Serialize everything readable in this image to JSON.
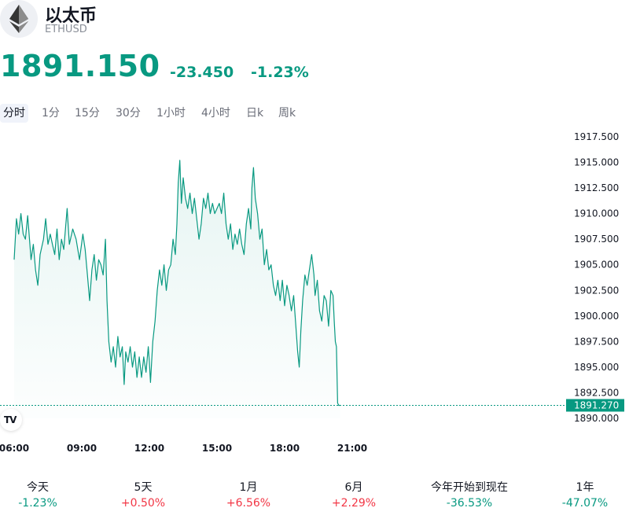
{
  "header": {
    "name": "以太币",
    "ticker": "ETHUSD",
    "price": "1891.150",
    "change": "-23.450",
    "change_pct": "-1.23%"
  },
  "tabs": [
    {
      "label": "分时",
      "active": true
    },
    {
      "label": "1分",
      "active": false
    },
    {
      "label": "15分",
      "active": false
    },
    {
      "label": "30分",
      "active": false
    },
    {
      "label": "1小时",
      "active": false
    },
    {
      "label": "4小时",
      "active": false
    },
    {
      "label": "日k",
      "active": false
    },
    {
      "label": "周k",
      "active": false
    }
  ],
  "colors": {
    "line": "#089981",
    "fill": "#e8f5f2",
    "negative": "#089981",
    "positive": "#f23645"
  },
  "chart_data": {
    "type": "area",
    "x_ticks": [
      "06:00",
      "09:00",
      "12:00",
      "15:00",
      "18:00",
      "21:00"
    ],
    "y_ticks": [
      "1917.500",
      "1915.000",
      "1912.500",
      "1910.000",
      "1907.500",
      "1905.000",
      "1902.500",
      "1900.000",
      "1897.500",
      "1895.000",
      "1892.500",
      "1890.000"
    ],
    "ylim": [
      1890.0,
      1917.5
    ],
    "last_price_label": "1891.270",
    "last_price": 1891.27,
    "x_hours_range": [
      6.0,
      22.25
    ],
    "points": [
      [
        6.0,
        1905.5
      ],
      [
        6.1,
        1909.5
      ],
      [
        6.2,
        1908.0
      ],
      [
        6.3,
        1910.0
      ],
      [
        6.4,
        1908.0
      ],
      [
        6.5,
        1907.5
      ],
      [
        6.6,
        1909.8
      ],
      [
        6.75,
        1905.5
      ],
      [
        6.85,
        1907.0
      ],
      [
        6.95,
        1904.5
      ],
      [
        7.05,
        1903.0
      ],
      [
        7.15,
        1906.0
      ],
      [
        7.3,
        1907.5
      ],
      [
        7.4,
        1909.5
      ],
      [
        7.5,
        1907.0
      ],
      [
        7.6,
        1908.0
      ],
      [
        7.7,
        1907.0
      ],
      [
        7.8,
        1906.0
      ],
      [
        7.9,
        1908.5
      ],
      [
        8.0,
        1905.5
      ],
      [
        8.1,
        1907.5
      ],
      [
        8.2,
        1906.5
      ],
      [
        8.35,
        1910.5
      ],
      [
        8.45,
        1907.0
      ],
      [
        8.6,
        1908.5
      ],
      [
        8.75,
        1907.5
      ],
      [
        8.9,
        1905.5
      ],
      [
        9.05,
        1908.0
      ],
      [
        9.15,
        1906.5
      ],
      [
        9.25,
        1904.0
      ],
      [
        9.35,
        1901.5
      ],
      [
        9.45,
        1904.5
      ],
      [
        9.55,
        1906.0
      ],
      [
        9.65,
        1903.5
      ],
      [
        9.75,
        1905.5
      ],
      [
        9.85,
        1905.0
      ],
      [
        9.95,
        1904.0
      ],
      [
        10.05,
        1907.5
      ],
      [
        10.12,
        1901.5
      ],
      [
        10.2,
        1897.5
      ],
      [
        10.3,
        1895.5
      ],
      [
        10.4,
        1897.0
      ],
      [
        10.5,
        1895.0
      ],
      [
        10.6,
        1898.0
      ],
      [
        10.7,
        1896.0
      ],
      [
        10.8,
        1897.0
      ],
      [
        10.88,
        1893.3
      ],
      [
        10.95,
        1896.5
      ],
      [
        11.05,
        1895.5
      ],
      [
        11.15,
        1897.0
      ],
      [
        11.25,
        1895.0
      ],
      [
        11.35,
        1896.5
      ],
      [
        11.45,
        1894.0
      ],
      [
        11.55,
        1896.0
      ],
      [
        11.65,
        1894.0
      ],
      [
        11.75,
        1896.0
      ],
      [
        11.85,
        1894.5
      ],
      [
        11.95,
        1897.0
      ],
      [
        12.0,
        1895.5
      ],
      [
        12.05,
        1893.5
      ],
      [
        12.15,
        1897.5
      ],
      [
        12.25,
        1899.5
      ],
      [
        12.35,
        1902.5
      ],
      [
        12.45,
        1904.5
      ],
      [
        12.55,
        1903.0
      ],
      [
        12.65,
        1905.0
      ],
      [
        12.75,
        1902.5
      ],
      [
        12.85,
        1904.5
      ],
      [
        12.95,
        1905.0
      ],
      [
        13.05,
        1907.5
      ],
      [
        13.15,
        1906.0
      ],
      [
        13.22,
        1909.0
      ],
      [
        13.28,
        1913.0
      ],
      [
        13.35,
        1915.2
      ],
      [
        13.42,
        1911.0
      ],
      [
        13.5,
        1913.5
      ],
      [
        13.6,
        1911.5
      ],
      [
        13.7,
        1910.5
      ],
      [
        13.8,
        1912.0
      ],
      [
        13.9,
        1910.0
      ],
      [
        14.0,
        1911.5
      ],
      [
        14.1,
        1909.5
      ],
      [
        14.2,
        1907.5
      ],
      [
        14.3,
        1909.0
      ],
      [
        14.4,
        1911.5
      ],
      [
        14.5,
        1910.5
      ],
      [
        14.6,
        1912.0
      ],
      [
        14.7,
        1910.0
      ],
      [
        14.8,
        1911.0
      ],
      [
        14.9,
        1910.0
      ],
      [
        15.0,
        1910.5
      ],
      [
        15.1,
        1911.0
      ],
      [
        15.2,
        1910.0
      ],
      [
        15.3,
        1912.0
      ],
      [
        15.4,
        1909.0
      ],
      [
        15.5,
        1907.5
      ],
      [
        15.6,
        1909.0
      ],
      [
        15.7,
        1906.5
      ],
      [
        15.8,
        1908.0
      ],
      [
        15.9,
        1907.0
      ],
      [
        16.0,
        1908.5
      ],
      [
        16.1,
        1907.0
      ],
      [
        16.2,
        1906.0
      ],
      [
        16.3,
        1909.0
      ],
      [
        16.4,
        1910.5
      ],
      [
        16.5,
        1908.5
      ],
      [
        16.55,
        1912.5
      ],
      [
        16.62,
        1914.5
      ],
      [
        16.7,
        1911.5
      ],
      [
        16.8,
        1910.0
      ],
      [
        16.9,
        1907.5
      ],
      [
        17.0,
        1908.5
      ],
      [
        17.1,
        1905.0
      ],
      [
        17.2,
        1906.5
      ],
      [
        17.3,
        1904.5
      ],
      [
        17.4,
        1905.0
      ],
      [
        17.5,
        1903.0
      ],
      [
        17.6,
        1902.0
      ],
      [
        17.7,
        1903.5
      ],
      [
        17.8,
        1901.5
      ],
      [
        17.9,
        1903.5
      ],
      [
        18.0,
        1901.0
      ],
      [
        18.1,
        1903.0
      ],
      [
        18.2,
        1902.0
      ],
      [
        18.3,
        1900.5
      ],
      [
        18.4,
        1902.0
      ],
      [
        18.5,
        1899.0
      ],
      [
        18.58,
        1896.5
      ],
      [
        18.65,
        1895.0
      ],
      [
        18.72,
        1898.5
      ],
      [
        18.8,
        1901.5
      ],
      [
        18.9,
        1904.0
      ],
      [
        19.0,
        1903.0
      ],
      [
        19.1,
        1904.5
      ],
      [
        19.2,
        1906.0
      ],
      [
        19.3,
        1904.0
      ],
      [
        19.35,
        1902.0
      ],
      [
        19.45,
        1903.5
      ],
      [
        19.55,
        1900.5
      ],
      [
        19.65,
        1899.5
      ],
      [
        19.75,
        1902.0
      ],
      [
        19.85,
        1901.5
      ],
      [
        19.95,
        1899.0
      ],
      [
        20.05,
        1902.5
      ],
      [
        20.15,
        1902.0
      ],
      [
        20.2,
        1899.5
      ],
      [
        20.25,
        1897.5
      ],
      [
        20.3,
        1897.0
      ],
      [
        20.35,
        1891.5
      ],
      [
        20.4,
        1891.27
      ],
      [
        20.47,
        1891.27
      ]
    ]
  },
  "performance": [
    {
      "label": "今天",
      "value": "-1.23%",
      "sign": "neg"
    },
    {
      "label": "5天",
      "value": "+0.50%",
      "sign": "pos"
    },
    {
      "label": "1月",
      "value": "+6.56%",
      "sign": "pos"
    },
    {
      "label": "6月",
      "value": "+2.29%",
      "sign": "pos"
    },
    {
      "label": "今年开始到现在",
      "value": "-36.53%",
      "sign": "neg"
    },
    {
      "label": "1年",
      "value": "-47.07%",
      "sign": "neg"
    }
  ]
}
